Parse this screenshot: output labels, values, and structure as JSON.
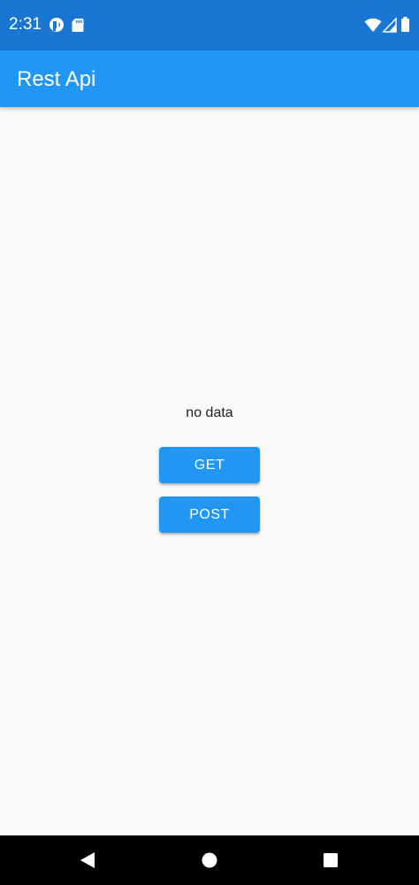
{
  "status_bar": {
    "time": "2:31",
    "background_color": "#1976d2",
    "icons_left": [
      "app-notification-icon",
      "sd-card-icon"
    ],
    "icons_right": [
      "wifi-icon",
      "cellular-signal-icon",
      "battery-icon"
    ]
  },
  "app_bar": {
    "title": "Rest Api",
    "background_color": "#2196f3"
  },
  "main": {
    "result_text": "no data",
    "get_button_label": "GET",
    "post_button_label": "POST",
    "button_color": "#2196f3"
  },
  "nav_bar": {
    "buttons": [
      "back-icon",
      "home-icon",
      "recents-icon"
    ]
  }
}
